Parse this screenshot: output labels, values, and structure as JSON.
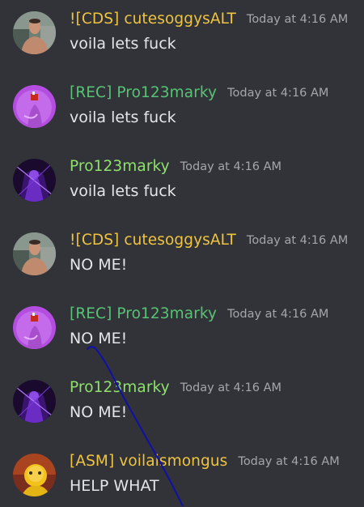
{
  "colors": {
    "background": "#313338",
    "timestamp": "#a3a6aa",
    "text": "#e3e5e8",
    "yellow_name": "#f0c43f",
    "green_name": "#57c374",
    "bright_green_name": "#8ee26b",
    "drawn_line": "#1010a8"
  },
  "messages": [
    {
      "username": "![CDS]  cutesoggysALT",
      "timestamp": "Today at 4:16 AM",
      "content": "voila lets fuck",
      "name_color": "#f0c43f",
      "avatar": "shirtless-man-avatar"
    },
    {
      "username": "[REC] Pro123marky",
      "timestamp": "Today at 4:16 AM",
      "content": "voila lets fuck",
      "name_color": "#57c374",
      "avatar": "purple-figure-avatar"
    },
    {
      "username": "Pro123marky",
      "timestamp": "Today at 4:16 AM",
      "content": "voila lets fuck",
      "name_color": "#8ee26b",
      "avatar": "dark-purple-figure-avatar"
    },
    {
      "username": "![CDS]  cutesoggysALT",
      "timestamp": "Today at 4:16 AM",
      "content": "NO ME!",
      "name_color": "#f0c43f",
      "avatar": "shirtless-man-avatar"
    },
    {
      "username": "[REC] Pro123marky",
      "timestamp": "Today at 4:16 AM",
      "content": "NO ME!",
      "name_color": "#57c374",
      "avatar": "purple-figure-avatar"
    },
    {
      "username": "Pro123marky",
      "timestamp": "Today at 4:16 AM",
      "content": "NO ME!",
      "name_color": "#8ee26b",
      "avatar": "dark-purple-figure-avatar"
    },
    {
      "username": "[ASM] voilaismongus",
      "timestamp": "Today at 4:16 AM",
      "content": "HELP WHAT",
      "name_color": "#f0c43f",
      "avatar": "yellow-character-avatar"
    }
  ]
}
